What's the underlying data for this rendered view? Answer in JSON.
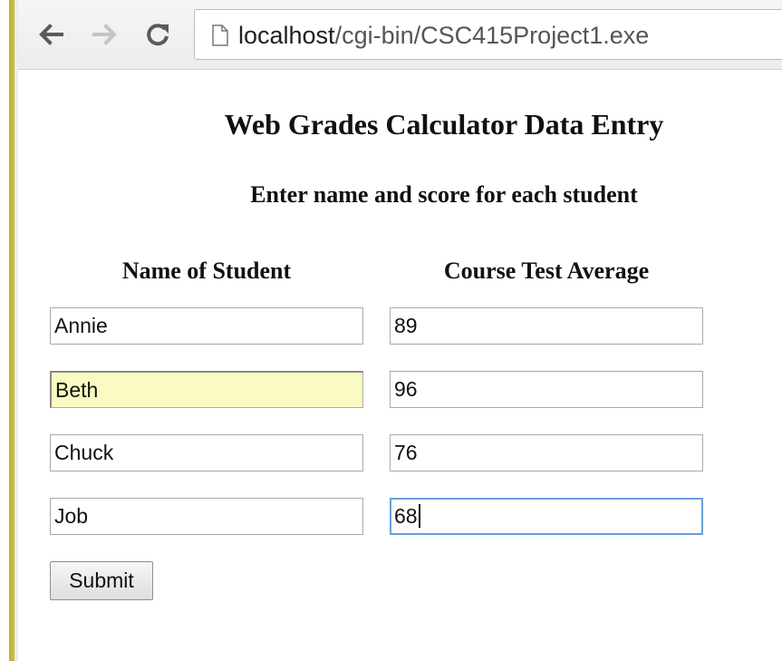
{
  "browser": {
    "url_host": "localhost",
    "url_path": "/cgi-bin/CSC415Project1.exe",
    "icons": {
      "back": "back-arrow-icon",
      "forward": "forward-arrow-icon",
      "reload": "reload-icon",
      "page": "page-icon"
    }
  },
  "page": {
    "title": "Web Grades Calculator Data Entry",
    "subtitle": "Enter name and score for each student",
    "columns": {
      "name_header": "Name of Student",
      "score_header": "Course Test Average"
    },
    "students": [
      {
        "name": "Annie",
        "score": "89"
      },
      {
        "name": "Beth",
        "score": "96"
      },
      {
        "name": "Chuck",
        "score": "76"
      },
      {
        "name": "Job",
        "score": "68"
      }
    ],
    "submit_label": "Submit"
  },
  "colors": {
    "autofill_bg": "#fafbc2",
    "focus_border": "#6b9fdc",
    "accent_bar": "#b9b327"
  }
}
